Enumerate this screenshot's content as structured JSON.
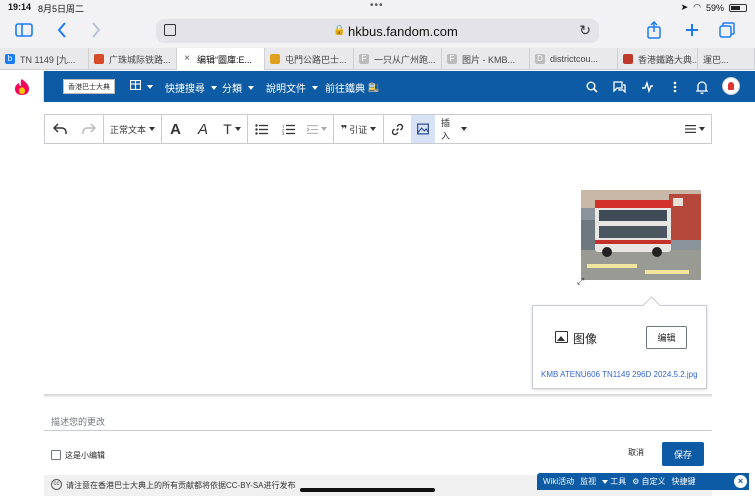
{
  "status_bar": {
    "time": "19:14",
    "date": "8月5日周二",
    "battery": "59%"
  },
  "browser": {
    "url": "hkbus.fandom.com",
    "tabs": [
      {
        "label": "TN 1149 [九...",
        "fav_color": "#1a7cf5",
        "fav_text": "b"
      },
      {
        "label": "广珠城际铁路...",
        "fav_color": "#d64a2a",
        "fav_text": ""
      },
      {
        "label": "编辑“圖庫:E...",
        "fav_color": "#666666",
        "fav_text": "×",
        "active": true
      },
      {
        "label": "屯門公路巴士...",
        "fav_color": "#e0a020",
        "fav_text": ""
      },
      {
        "label": "一只从广州跑...",
        "fav_color": "#bbbbbb",
        "fav_text": "F"
      },
      {
        "label": "图片 - KMB...",
        "fav_color": "#bbbbbb",
        "fav_text": "F"
      },
      {
        "label": "districtcou...",
        "fav_color": "#bbbbbb",
        "fav_text": "D"
      },
      {
        "label": "香港鐵路大典...",
        "fav_color": "#c0392b",
        "fav_text": ""
      },
      {
        "label": "運巴...",
        "fav_color": "#bbbbbb",
        "fav_text": ""
      }
    ]
  },
  "wiki_header": {
    "logo_text": "香港巴士大典",
    "nav": [
      "快捷搜尋",
      "分類",
      "說明文件",
      "前往鐵典"
    ]
  },
  "editor_toolbar": {
    "paragraph_format": "正常文本",
    "cite_label": "引证",
    "insert_label": "插入"
  },
  "image_popup": {
    "type_label": "图像",
    "edit_label": "编辑",
    "filename": "KMB ATENU606 TN1149 296D 2024.5.2.jpg"
  },
  "save_area": {
    "summary_placeholder": "描述您的更改",
    "minor_edit_label": "这是小编辑",
    "cancel_label": "取消",
    "save_label": "保存",
    "license_text": "请注意在香港巴士大典上的所有贡献都将依据CC-BY-SA进行发布"
  },
  "wiki_tools": {
    "items": [
      "Wiki活动",
      "监视",
      "工具",
      "自定义",
      "快捷键"
    ]
  },
  "colors": {
    "accent": "#0d5ba5",
    "link": "#3366cc",
    "ios_blue": "#1a7cf5"
  }
}
